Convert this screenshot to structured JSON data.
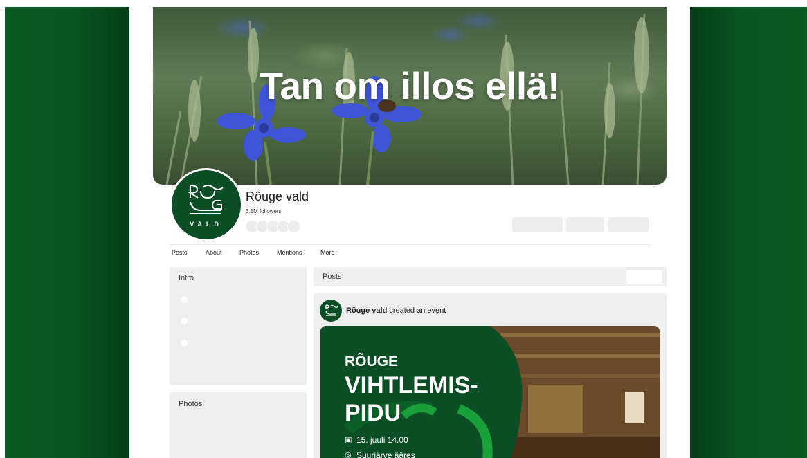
{
  "cover": {
    "title": "Tan om illos ellä!"
  },
  "profile": {
    "logo_text": "VALD",
    "name": "Rõuge vald",
    "followers": "3.1M followers"
  },
  "tabs": [
    "Posts",
    "About",
    "Photos",
    "Mentions",
    "More"
  ],
  "left": {
    "intro_title": "Intro",
    "photos_title": "Photos"
  },
  "posts": {
    "header": "Posts",
    "author": "Rõuge vald",
    "action": " created an event",
    "event": {
      "line1": "RÕUGE",
      "line2": "VIHTLEMIS-",
      "line3": "PIDU",
      "date": "15. juuli 14.00",
      "place": "Suurjärve ääres",
      "calendar_icon": "calendar-icon",
      "location_icon": "location-pin-icon"
    }
  },
  "colors": {
    "brand_green": "#0b4d24",
    "side_green": "#0a5523"
  }
}
